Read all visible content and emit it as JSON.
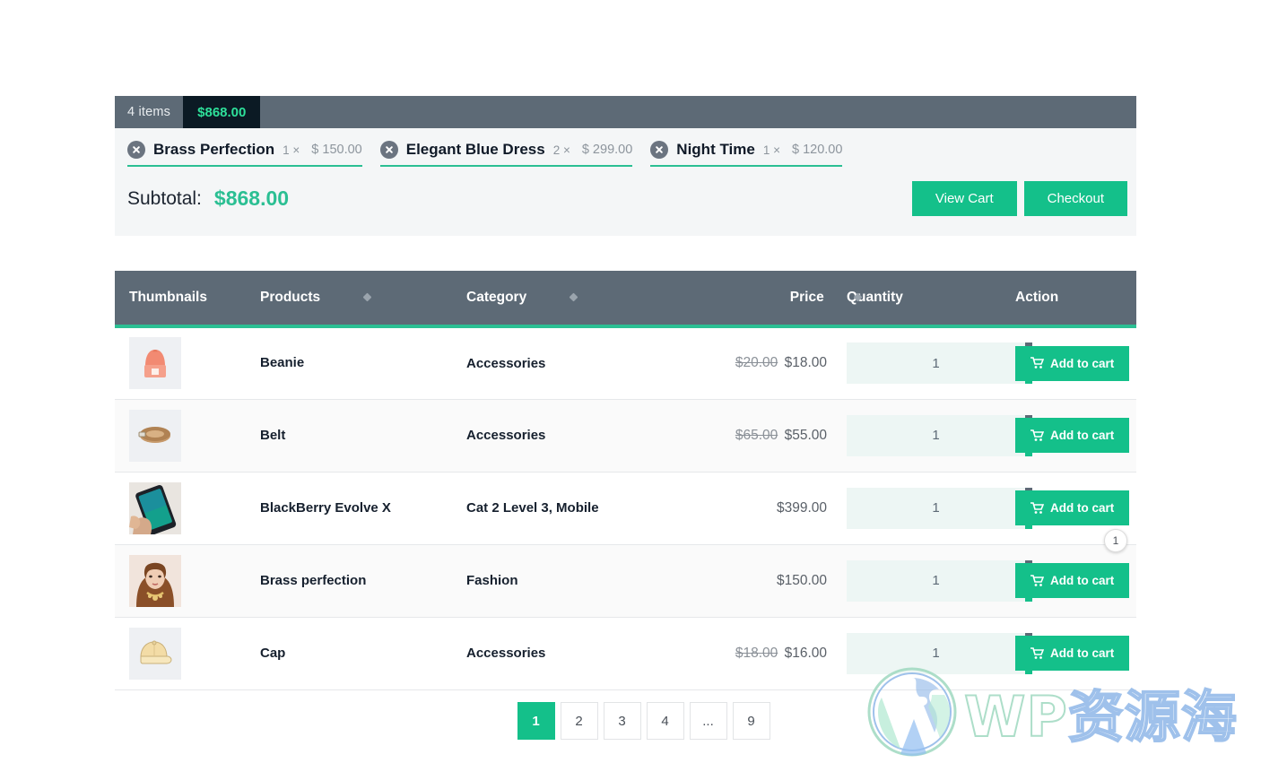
{
  "cart": {
    "items_count_label": "4 items",
    "total": "$868.00",
    "items": [
      {
        "name": "Brass Perfection",
        "qty": "1 ×",
        "price": "$ 150.00",
        "remove_icon": "close-circle-icon"
      },
      {
        "name": "Elegant Blue Dress",
        "qty": "2 ×",
        "price": "$ 299.00",
        "remove_icon": "close-circle-icon"
      },
      {
        "name": "Night Time",
        "qty": "1 ×",
        "price": "$ 120.00",
        "remove_icon": "close-circle-icon"
      }
    ],
    "subtotal_label": "Subtotal:",
    "subtotal_value": "$868.00",
    "view_cart_label": "View Cart",
    "checkout_label": "Checkout"
  },
  "table": {
    "columns": {
      "thumbnails": "Thumbnails",
      "products": "Products",
      "category": "Category",
      "price": "Price",
      "quantity": "Quantity",
      "action": "Action"
    },
    "sort_icon": "sort-diamond-icon",
    "add_to_cart_label": "Add to cart",
    "cart_icon": "shopping-cart-icon",
    "qty_plus_label": "+",
    "qty_minus_label": "−",
    "rows": [
      {
        "thumb": "beanie-thumbnail",
        "product": "Beanie",
        "category": "Accessories",
        "price_old": "$20.00",
        "price_new": "$18.00",
        "quantity": "1",
        "badge": ""
      },
      {
        "thumb": "belt-thumbnail",
        "product": "Belt",
        "category": "Accessories",
        "price_old": "$65.00",
        "price_new": "$55.00",
        "quantity": "1",
        "badge": ""
      },
      {
        "thumb": "blackberry-thumbnail",
        "product": "BlackBerry Evolve X",
        "category": "Cat 2 Level 3, Mobile",
        "price_old": "",
        "price_new": "$399.00",
        "quantity": "1",
        "badge": ""
      },
      {
        "thumb": "brass-perfection-thumbnail",
        "product": "Brass perfection",
        "category": "Fashion",
        "price_old": "",
        "price_new": "$150.00",
        "quantity": "1",
        "badge": "1"
      },
      {
        "thumb": "cap-thumbnail",
        "product": "Cap",
        "category": "Accessories",
        "price_old": "$18.00",
        "price_new": "$16.00",
        "quantity": "1",
        "badge": ""
      }
    ]
  },
  "pagination": {
    "pages": [
      "1",
      "2",
      "3",
      "4",
      "...",
      "9"
    ],
    "active": "1"
  },
  "watermark": {
    "logo_icon": "wordpress-logo-icon",
    "text_wp": "WP",
    "text_cn": "资源海"
  },
  "colors": {
    "accent_teal": "#14c08a",
    "accent_teal_light": "#2bbf93",
    "header_slate": "#5d6a76",
    "total_badge_bg": "#0b1a24",
    "total_badge_text": "#2ee09a"
  }
}
